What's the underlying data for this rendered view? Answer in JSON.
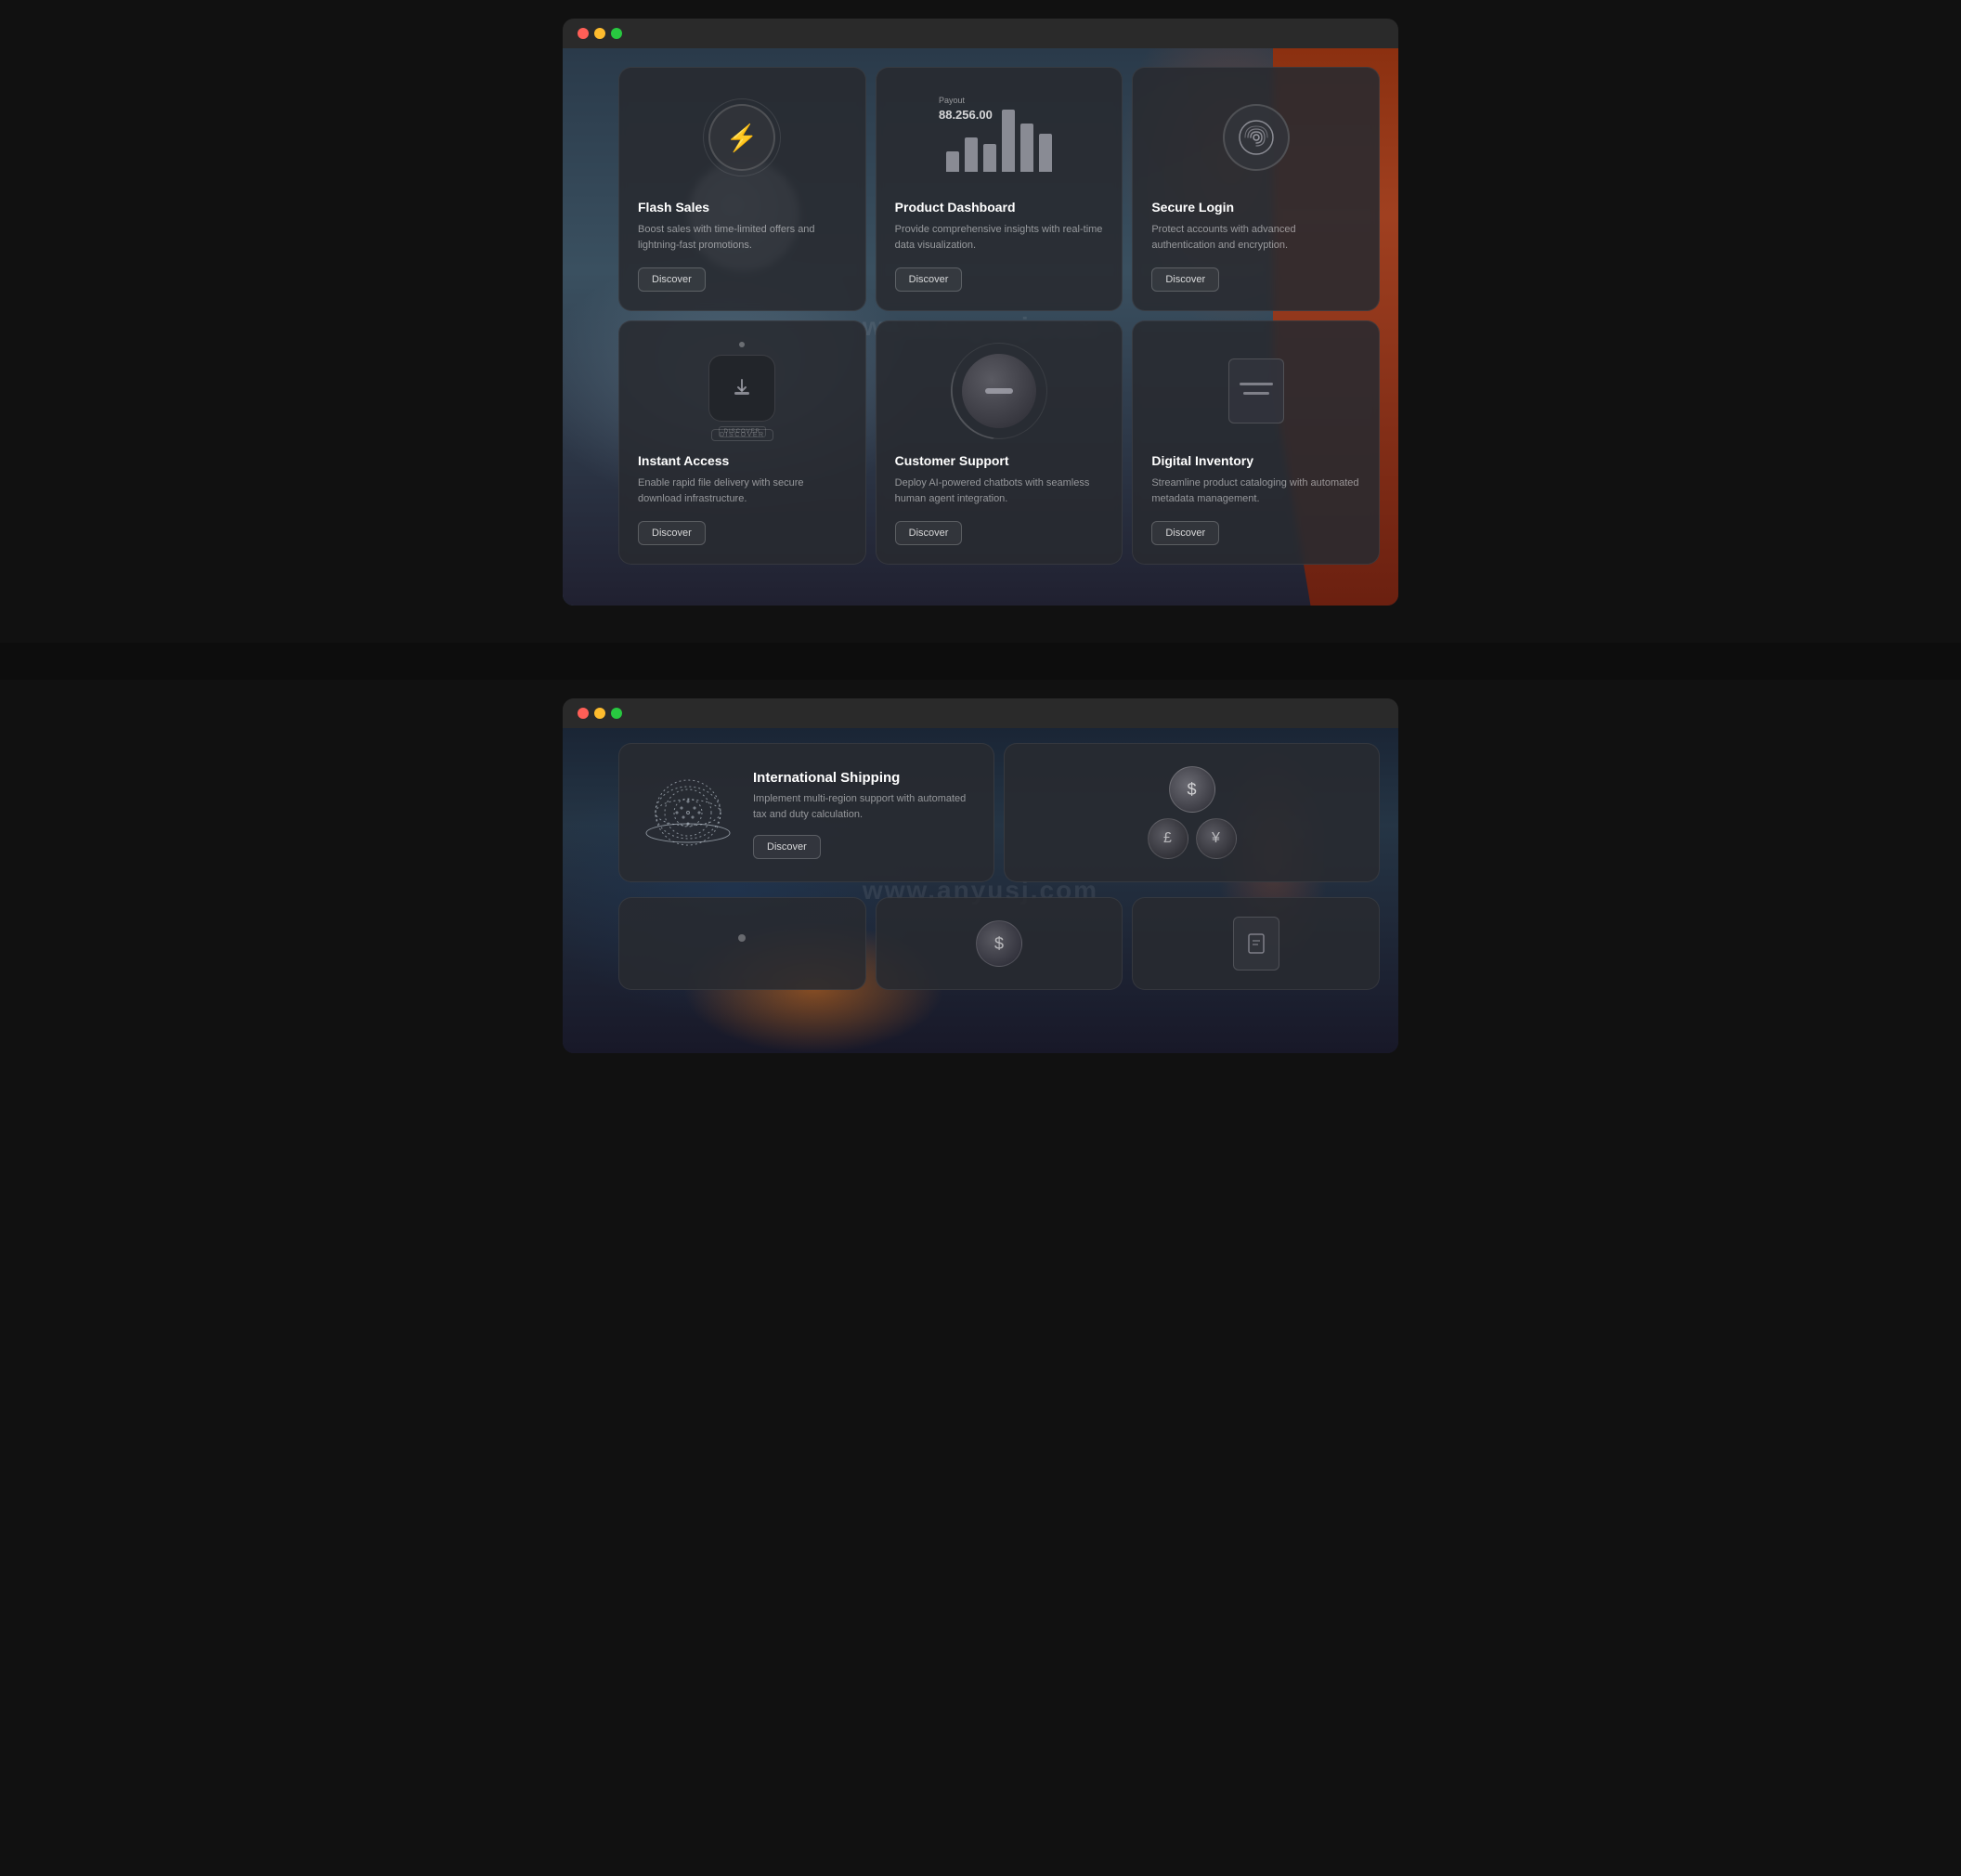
{
  "watermark": "www.anyusj.com",
  "window1": {
    "dots": [
      "red",
      "yellow",
      "green"
    ],
    "cards": [
      {
        "id": "flash-sales",
        "title": "Flash Sales",
        "description": "Boost sales with time-limited offers and lightning-fast promotions.",
        "icon": "lightning",
        "discover": "Discover"
      },
      {
        "id": "product-dashboard",
        "title": "Product Dashboard",
        "description": "Provide comprehensive insights with real-time data visualization.",
        "icon": "chart",
        "discover": "Discover",
        "payout_label": "Payout",
        "payout_amount": "88.256.00"
      },
      {
        "id": "secure-login",
        "title": "Secure Login",
        "description": "Protect accounts with advanced authentication and encryption.",
        "icon": "fingerprint",
        "discover": "Discover"
      },
      {
        "id": "instant-access",
        "title": "Instant Access",
        "description": "Enable rapid file delivery with secure download infrastructure.",
        "icon": "download",
        "discover": "Discover"
      },
      {
        "id": "customer-support",
        "title": "Customer Support",
        "description": "Deploy AI-powered chatbots with seamless human agent integration.",
        "icon": "sphere",
        "discover": "Discover"
      },
      {
        "id": "digital-inventory",
        "title": "Digital Inventory",
        "description": "Streamline product cataloging with automated metadata management.",
        "icon": "document",
        "discover": "Discover"
      }
    ]
  },
  "window2": {
    "dots": [
      "red",
      "yellow",
      "green"
    ],
    "main_card": {
      "title": "International Shipping",
      "description": "Implement multi-region support with automated tax and duty calculation.",
      "discover": "Discover"
    },
    "currency_card": {
      "currencies": [
        "$",
        "£",
        "¥"
      ]
    },
    "partial_cards": [
      {
        "icon": "dot"
      },
      {
        "icon": "dollar"
      },
      {
        "icon": "document"
      }
    ]
  }
}
